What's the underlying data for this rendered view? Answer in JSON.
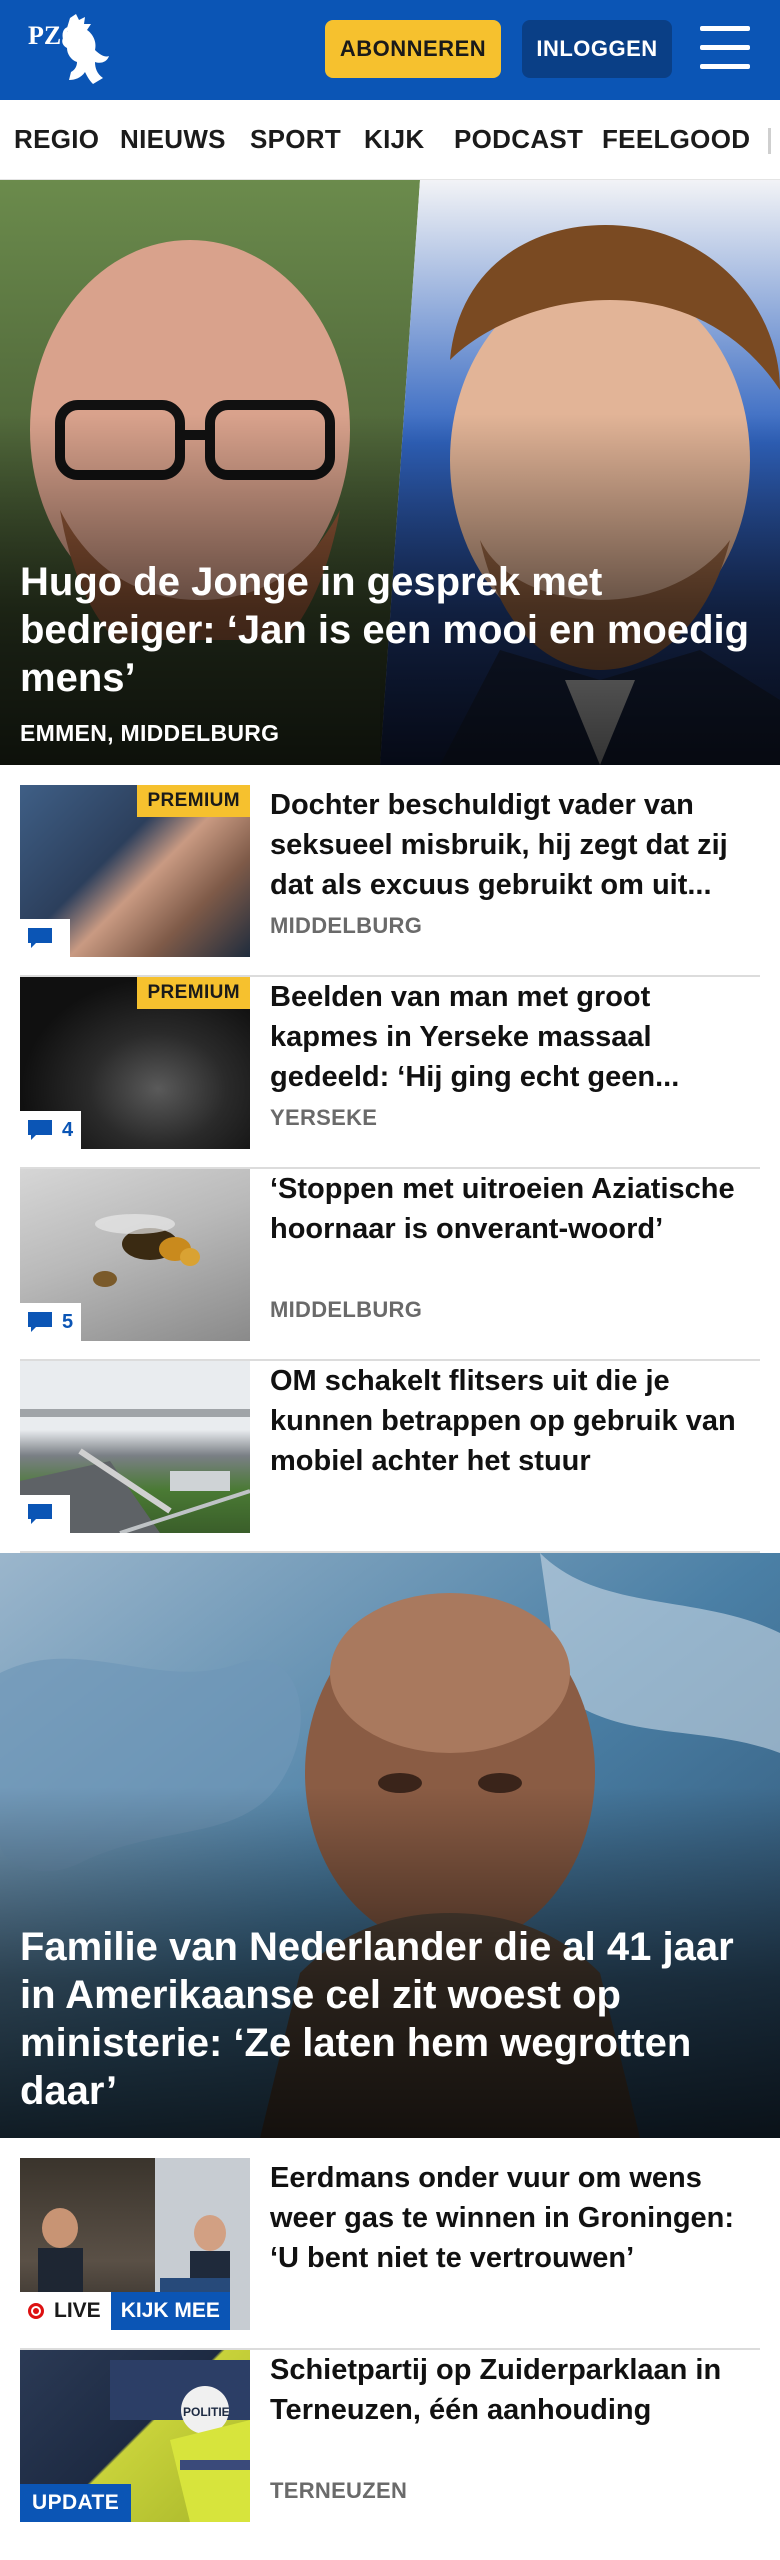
{
  "header": {
    "logo_text": "PZC",
    "subscribe_label": "ABONNEREN",
    "login_label": "INLOGGEN",
    "menu_icon": "hamburger-menu-icon",
    "background_color": "#0b55b5",
    "accent_color": "#f6c12e"
  },
  "nav": {
    "items": [
      "REGIO",
      "NIEUWS",
      "SPORT",
      "KIJK",
      "PODCAST",
      "FEELGOOD"
    ]
  },
  "hero1": {
    "title": "Hugo de Jonge in gesprek met bedreiger: ‘Jan is een mooi en moedig mens’",
    "location": "EMMEN, MIDDELBURG"
  },
  "articles": [
    {
      "badge": "PREMIUM",
      "title": "Dochter beschuldigt vader van seksueel misbruik, hij zegt dat zij dat als excuus gebruikt om uit...",
      "location": "MIDDELBURG",
      "comment_count": ""
    },
    {
      "badge": "PREMIUM",
      "title": "Beelden van man met groot kapmes in Yerseke massaal gedeeld: ‘Hij ging echt geen...",
      "location": "YERSEKE",
      "comment_count": "4"
    },
    {
      "title": "‘Stoppen met uitroeien Aziatische hoornaar is onverant-woord’",
      "location": "MIDDELBURG",
      "comment_count": "5"
    },
    {
      "title": "OM schakelt flitsers uit die je kunnen betrappen op gebruik van mobiel achter het stuur",
      "comment_count": ""
    }
  ],
  "hero2": {
    "title": "Familie van Nederlander die al 41 jaar in Amerikaanse cel zit woest op ministerie: ‘Ze laten hem wegrotten daar’"
  },
  "articles2": [
    {
      "title": "Eerdmans onder vuur om wens weer gas te winnen in Groningen: ‘U bent niet te vertrouwen’",
      "live_label": "LIVE",
      "watch_label": "KIJK MEE"
    },
    {
      "title": "Schietpartij op Zuiderparklaan in Terneuzen, één aanhouding",
      "location": "TERNEUZEN",
      "badge": "UPDATE"
    }
  ]
}
